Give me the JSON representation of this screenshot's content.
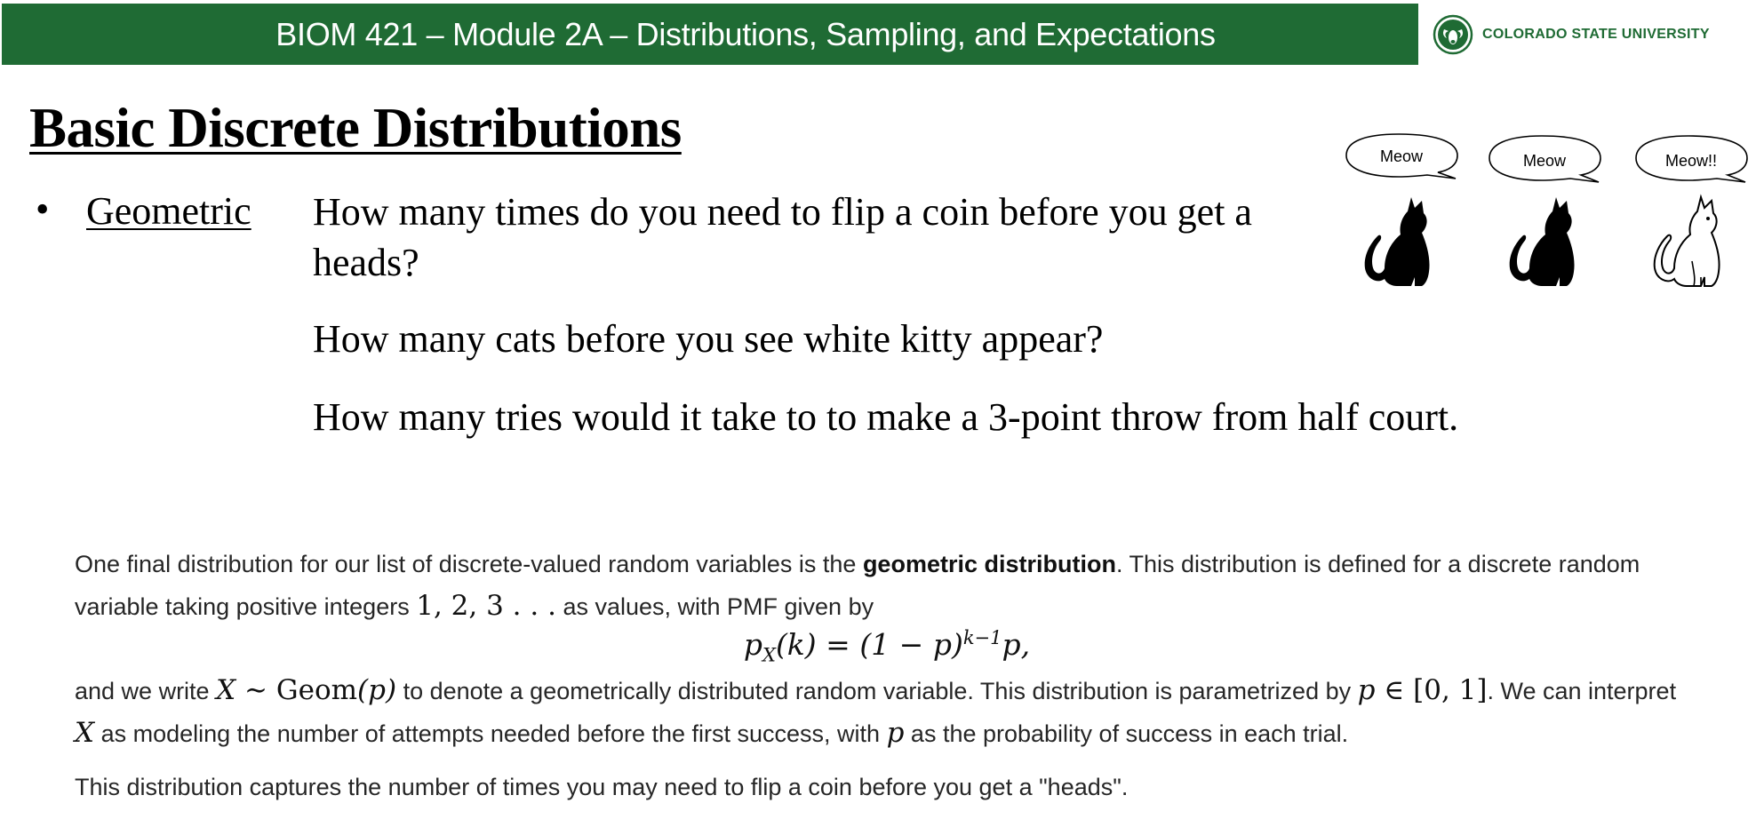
{
  "header": {
    "title": "BIOM 421 – Module 2A – Distributions, Sampling, and Expectations",
    "logo_text": "COLORADO STATE UNIVERSITY",
    "bg_color": "#1f6b34"
  },
  "slide": {
    "title": "Basic Discrete Distributions",
    "bullet_label": "Geometric",
    "questions": [
      "How many times do you need to flip a coin before you get a heads?",
      "How many cats before you see white kitty appear?",
      "How many tries would it take to to make a 3-point throw from half court."
    ],
    "speech": [
      "Meow",
      "Meow",
      "Meow!!"
    ],
    "cats": [
      "black-cat-icon",
      "black-cat-icon",
      "white-cat-icon"
    ]
  },
  "text": {
    "p1_a": "One final distribution for our list of discrete-valued random variables is the ",
    "p1_bold": "geometric distribution",
    "p1_b": ". This distribution is defined for a discrete random variable taking positive integers ",
    "p1_vals": "1, 2, 3 . . .",
    "p1_c": " as values, with PMF given by",
    "formula_lhs": "p",
    "formula_sub": "X",
    "formula_mid": "(k) = (1 − p)",
    "formula_sup": "k−1",
    "formula_end": "p,",
    "p2_a": "and we write ",
    "p2_x": "X",
    "p2_tilde": " ∼ ",
    "p2_geom": "Geom",
    "p2_geomarg": "(p)",
    "p2_b": " to denote a geometrically distributed random variable. This distribution is parametrized by ",
    "p2_p": "p",
    "p2_in": " ∈ [0, 1]",
    "p2_c": ". We can interpret ",
    "p2_x2": "X",
    "p2_d": " as modeling the number of attempts needed before the first success, with ",
    "p2_p2": "p",
    "p2_e": " as the probability of success in each trial.",
    "p3": "This distribution captures the number of times you may need to flip a coin before you get a \"heads\"."
  }
}
